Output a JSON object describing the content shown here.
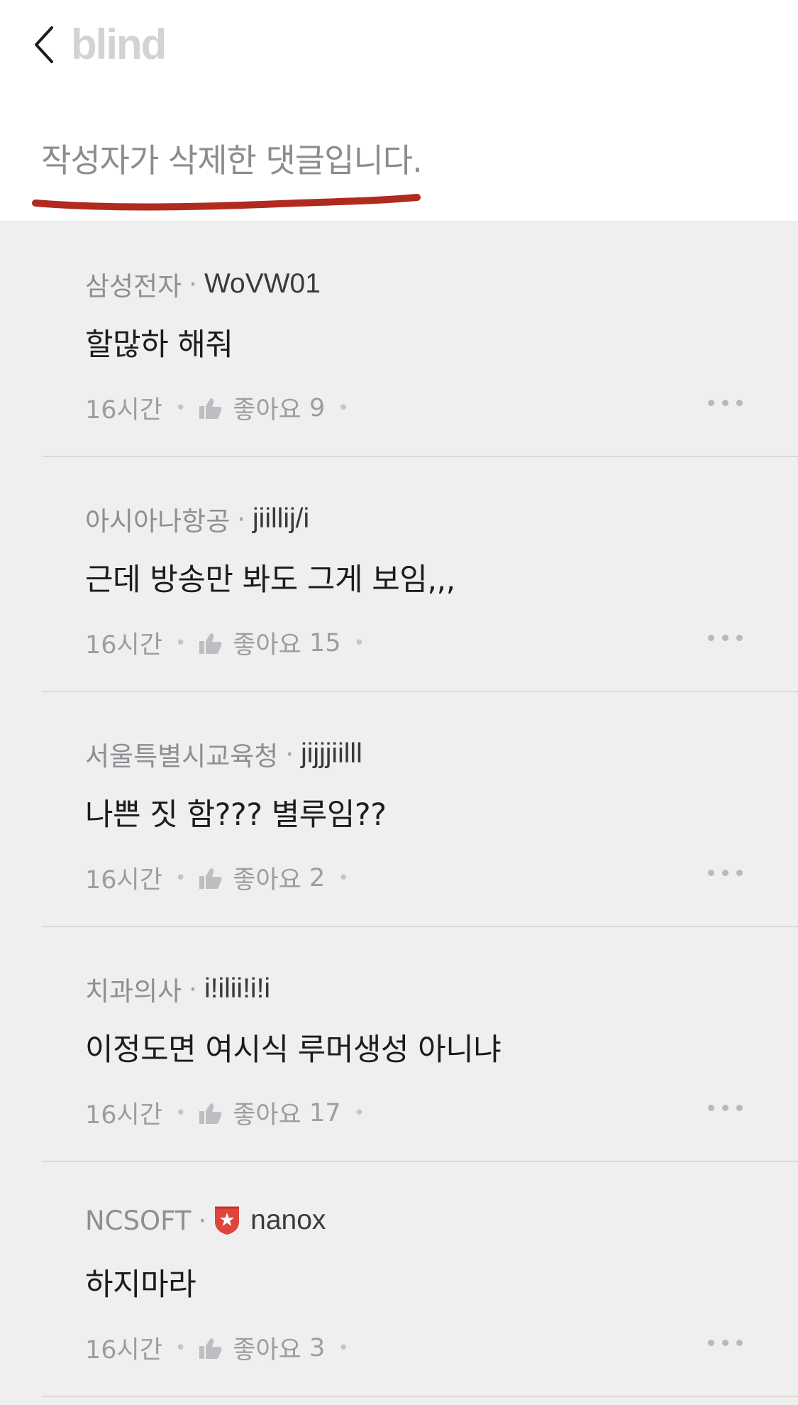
{
  "header": {
    "logo": "blind",
    "deleted_message": "작성자가 삭제한 댓글입니다."
  },
  "colors": {
    "annotation_underline": "#b02a1e",
    "list_background": "#efeff0",
    "badge_red": "#e0443a"
  },
  "icons": {
    "back": "chevron-left-icon",
    "like": "thumbs-up-icon",
    "more": "more-horizontal-icon",
    "badge": "verified-company-badge-icon"
  },
  "comments": [
    {
      "company": "삼성전자",
      "nickname": "WoVW01",
      "text": "할많하 해줘",
      "time": "16시간",
      "like_label": "좋아요",
      "likes": "9"
    },
    {
      "company": "아시아나항공",
      "nickname": "jiillij/i",
      "text": "근데 방송만 봐도 그게 보임,,,",
      "time": "16시간",
      "like_label": "좋아요",
      "likes": "15"
    },
    {
      "company": "서울특별시교육청",
      "nickname": "jijjjiilll",
      "text": "나쁜 짓 함??? 별루임??",
      "time": "16시간",
      "like_label": "좋아요",
      "likes": "2"
    },
    {
      "company": "치과의사",
      "nickname": "i!ilii!i!i",
      "text": "이정도면 여시식 루머생성 아니냐",
      "time": "16시간",
      "like_label": "좋아요",
      "likes": "17"
    },
    {
      "company": "NCSOFT",
      "nickname": "nanox",
      "text": "하지마라",
      "time": "16시간",
      "like_label": "좋아요",
      "likes": "3"
    }
  ]
}
